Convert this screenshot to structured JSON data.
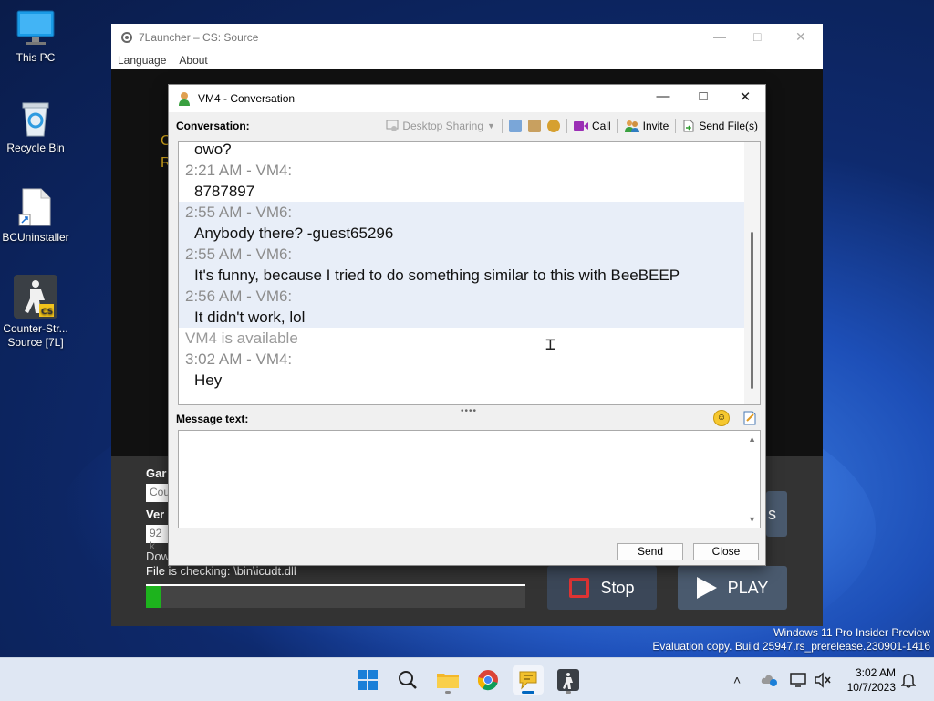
{
  "desktop": {
    "icons": [
      {
        "label": "This PC",
        "name": "this-pc-icon"
      },
      {
        "label": "Recycle Bin",
        "name": "recycle-bin-icon"
      },
      {
        "label": "BCUninstaller",
        "name": "bcuninstaller-icon"
      },
      {
        "label_line1": "Counter-Str...",
        "label_line2": "Source [7L]",
        "name": "counter-strike-icon"
      }
    ]
  },
  "launcher": {
    "title": "7Launcher – CS: Source",
    "menu": [
      "Language",
      "About"
    ],
    "yellow_c": "C",
    "yellow_r": "R",
    "labels": {
      "game": "Gar",
      "version": "Ver",
      "download": "Dow"
    },
    "fields": {
      "game": "Cou",
      "version": "92 k"
    },
    "status": "File is checking: \\bin\\icudt.dll",
    "progress": 0.04,
    "stop_label": "Stop",
    "play_label": "PLAY",
    "right_stub": "s"
  },
  "conversation": {
    "title": "VM4 - Conversation",
    "label": "Conversation:",
    "toolbar": {
      "desktop_sharing": "Desktop Sharing",
      "call": "Call",
      "invite": "Invite",
      "send_files": "Send File(s)"
    },
    "messages": [
      {
        "head": "",
        "body": "owo?"
      },
      {
        "head": "2:21 AM - VM4:",
        "body": "8787897"
      },
      {
        "head": "2:55 AM - VM6:",
        "body": "Anybody there? -guest65296"
      },
      {
        "head": "2:55 AM - VM6:",
        "body": "It's funny, because I tried to do something similar to this with BeeBEEP"
      },
      {
        "head": "2:56 AM - VM6:",
        "body": "It didn't work, lol"
      }
    ],
    "status_line": "VM4 is available",
    "last_message": {
      "head": "3:02 AM - VM4:",
      "body": "Hey"
    },
    "message_label": "Message text:",
    "input_value": "",
    "send_label": "Send",
    "close_label": "Close"
  },
  "watermark": {
    "line1": "Windows 11 Pro Insider Preview",
    "line2": "Evaluation copy. Build 25947.rs_prerelease.230901-1416"
  },
  "taskbar": {
    "time": "3:02 AM",
    "date": "10/7/2023"
  },
  "colors": {
    "accent": "#0067c0",
    "play_green": "#1db31d",
    "stop_red": "#dd3333",
    "highlight_row": "#e8eef8"
  }
}
